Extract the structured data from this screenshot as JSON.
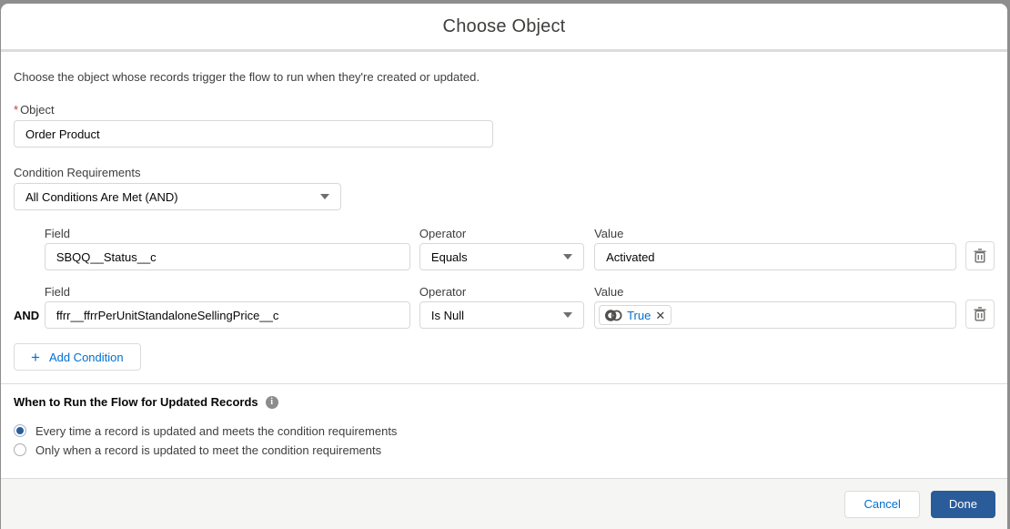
{
  "dialog": {
    "title": "Choose Object",
    "description": "Choose the object whose records trigger the flow to run when they're created or updated.",
    "object_field": {
      "required_mark": "*",
      "label": "Object",
      "value": "Order Product"
    },
    "condition_requirements": {
      "label": "Condition Requirements",
      "value": "All Conditions Are Met (AND)"
    },
    "columns": {
      "field": "Field",
      "operator": "Operator",
      "value": "Value"
    },
    "conditions": [
      {
        "prefix": "",
        "field": "SBQQ__Status__c",
        "operator": "Equals",
        "value": "Activated"
      },
      {
        "prefix": "AND",
        "field": "ffrr__ffrrPerUnitStandaloneSellingPrice__c",
        "operator": "Is Null",
        "value": "True"
      }
    ],
    "add_condition": {
      "plus": "+",
      "label": "Add Condition"
    },
    "when_to_run": {
      "heading": "When to Run the Flow for Updated Records",
      "info_glyph": "i",
      "options": [
        {
          "label": "Every time a record is updated and meets the condition requirements",
          "selected": true
        },
        {
          "label": "Only when a record is updated to meet the condition requirements",
          "selected": false
        }
      ]
    },
    "footer": {
      "cancel_label": "Cancel",
      "done_label": "Done"
    },
    "pill_remove_glyph": "✕"
  },
  "colors": {
    "accent_blue": "#0070d2",
    "brand_navy": "#2a5c9a",
    "required_red": "#c23934",
    "border_gray": "#dddbda",
    "label_gray": "#3e3e3c",
    "text_dark": "#080707",
    "footer_bg": "#f5f5f4",
    "icon_gray": "#706e6b",
    "backdrop_gray": "#8e8e8e"
  }
}
